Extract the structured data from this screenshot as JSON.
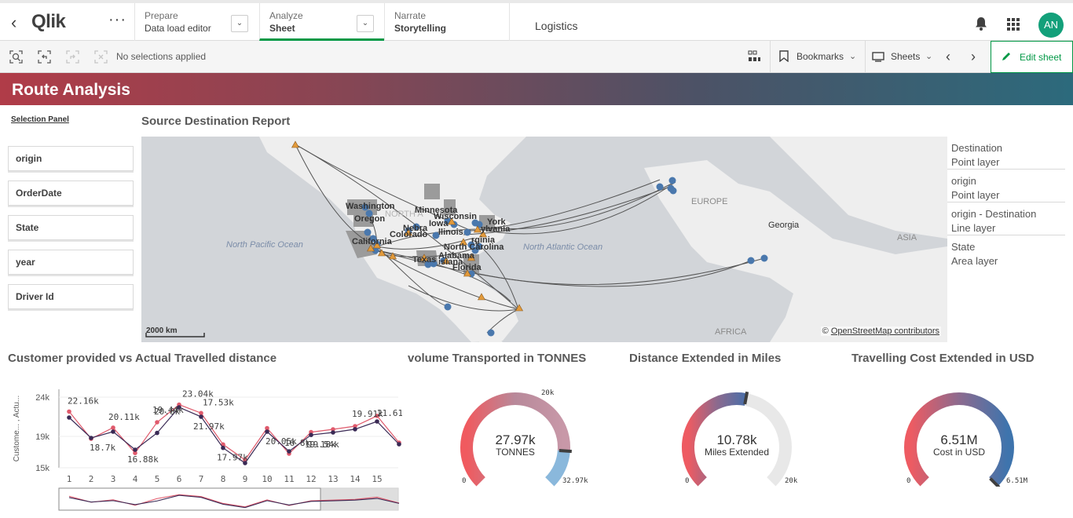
{
  "nav": {
    "logo": "Qlik",
    "prepare_small": "Prepare",
    "prepare_big": "Data load editor",
    "analyze_small": "Analyze",
    "analyze_big": "Sheet",
    "narrate_small": "Narrate",
    "narrate_big": "Storytelling",
    "app_name": "Logistics",
    "avatar_initials": "AN"
  },
  "toolbar": {
    "no_selections": "No selections applied",
    "bookmarks": "Bookmarks",
    "sheets": "Sheets",
    "edit_sheet": "Edit sheet"
  },
  "sheet": {
    "title": "Route Analysis",
    "selection_panel": "Selection Panel",
    "filters": [
      "origin",
      "OrderDate",
      "State",
      "year",
      "Driver Id"
    ]
  },
  "map": {
    "title": "Source Destination Report",
    "labels": {
      "europe": "EUROPE",
      "asia": "ASIA",
      "africa": "AFRICA",
      "georgia": "Georgia",
      "north_pacific": "North Pacific Ocean",
      "north_atlantic": "North Atlantic Ocean",
      "north_am": "NORTH A",
      "washington": "Washington",
      "oregon": "Oregon",
      "minnesota": "Minnesota",
      "wisconsin": "Wisconsin",
      "new_york": "York",
      "california": "California",
      "colorado": "Colorado",
      "nebraska": "Nebra",
      "illinois": "llinois",
      "iowa": "Iowa",
      "pennsylvania": "ylvania",
      "virginia": "rginia",
      "north_carolina": "North Carolina",
      "texas": "Texas",
      "alabama": "Alabama",
      "louisiana": "isiana",
      "florida": "Florida"
    },
    "scale_label": "2000 km",
    "credit_prefix": "©",
    "credit_link": "OpenStreetMap contributors",
    "layers": [
      {
        "name": "Destination",
        "type": "Point layer"
      },
      {
        "name": "origin",
        "type": "Point layer"
      },
      {
        "name": "origin - Destination",
        "type": "Line layer"
      },
      {
        "name": "State",
        "type": "Area layer"
      }
    ],
    "colors": {
      "destination": "#4a78ad",
      "origin": "#e29a3b",
      "area": "#9b9b9b"
    }
  },
  "line_chart": {
    "title": "Customer provided vs Actual Travelled distance",
    "y_axis_label": "Custome... , Actu...",
    "y_ticks": [
      "24k",
      "19k",
      "15k"
    ],
    "x_ticks": [
      "1",
      "2",
      "3",
      "4",
      "5",
      "6",
      "7",
      "8",
      "9",
      "10",
      "11",
      "12",
      "13",
      "14",
      "15"
    ]
  },
  "chart_data": {
    "type": "line",
    "x": [
      1,
      2,
      3,
      4,
      5,
      6,
      7,
      8,
      9,
      10,
      11,
      12,
      13,
      14,
      15,
      16
    ],
    "ylim": [
      15000,
      25000
    ],
    "series": [
      {
        "values": [
          22160,
          18700,
          20110,
          16880,
          20800,
          23040,
          21970,
          17970,
          16000,
          20050,
          16800,
          19540,
          19900,
          20300,
          21610,
          18200
        ],
        "color": "#e05a6c"
      },
      {
        "values": [
          21400,
          18800,
          19600,
          17300,
          19440,
          22700,
          21500,
          17530,
          15600,
          19600,
          17100,
          19180,
          19500,
          19910,
          20900,
          18000
        ],
        "color": "#3a2a55"
      }
    ],
    "data_labels": [
      {
        "x": 1,
        "text": "22.16k"
      },
      {
        "x": 2,
        "text": "18.7k"
      },
      {
        "x": 3,
        "text": "20.11k"
      },
      {
        "x": 4,
        "text": "16.88k"
      },
      {
        "x": 5,
        "text": "20.8k"
      },
      {
        "x": 5,
        "text": "19.44k"
      },
      {
        "x": 6,
        "text": "23.04k"
      },
      {
        "x": 7,
        "text": "21.97k"
      },
      {
        "x": 7,
        "text": "17.53k"
      },
      {
        "x": 8,
        "text": "17.97k"
      },
      {
        "x": 10,
        "text": "20.05k"
      },
      {
        "x": 11,
        "text": "16.8k"
      },
      {
        "x": 12,
        "text": "19.54k"
      },
      {
        "x": 12,
        "text": "19.18k"
      },
      {
        "x": 14,
        "text": "19.91k"
      },
      {
        "x": 15,
        "text": "21.61k"
      }
    ]
  },
  "gauges": [
    {
      "title": "volume Transported in TONNES",
      "value_text": "27.97k",
      "unit": "TONNES",
      "min_label": "0",
      "max_label": "32.97k",
      "segment_label": "20k",
      "value": 27970,
      "max": 32970
    },
    {
      "title": "Distance Extended in Miles",
      "value_text": "10.78k",
      "unit": "Miles Extended",
      "min_label": "0",
      "max_label": "20k",
      "value": 10780,
      "max": 20000
    },
    {
      "title": "Travelling Cost Extended in USD",
      "value_text": "6.51M",
      "unit": "Cost in USD",
      "min_label": "0",
      "max_label": "6.51M",
      "value": 6510000,
      "max": 6510000
    }
  ]
}
